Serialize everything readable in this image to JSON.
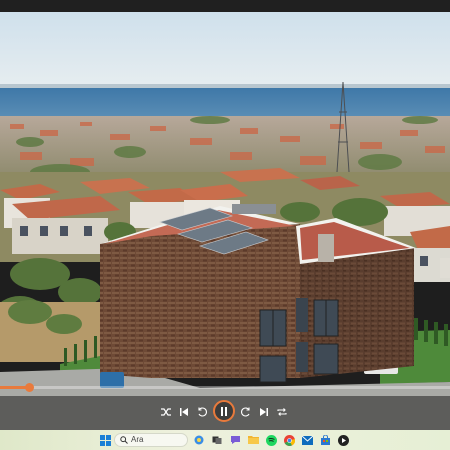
{
  "player": {
    "progress": 0.065,
    "accent_color": "#e87a3c"
  },
  "controls": {
    "shuffle_icon": "shuffle-icon",
    "previous_icon": "previous-icon",
    "rewind_icon": "rewind-10-icon",
    "play_pause_icon": "pause-icon",
    "forward_icon": "forward-30-icon",
    "next_icon": "next-icon",
    "repeat_icon": "repeat-icon"
  },
  "taskbar": {
    "search_placeholder": "Ara",
    "icons": [
      "windows-start-icon",
      "search-icon",
      "copilot-icon",
      "task-view-icon",
      "chat-icon",
      "file-explorer-icon",
      "spotify-icon",
      "chrome-icon",
      "mail-icon",
      "store-icon",
      "media-player-icon"
    ]
  }
}
